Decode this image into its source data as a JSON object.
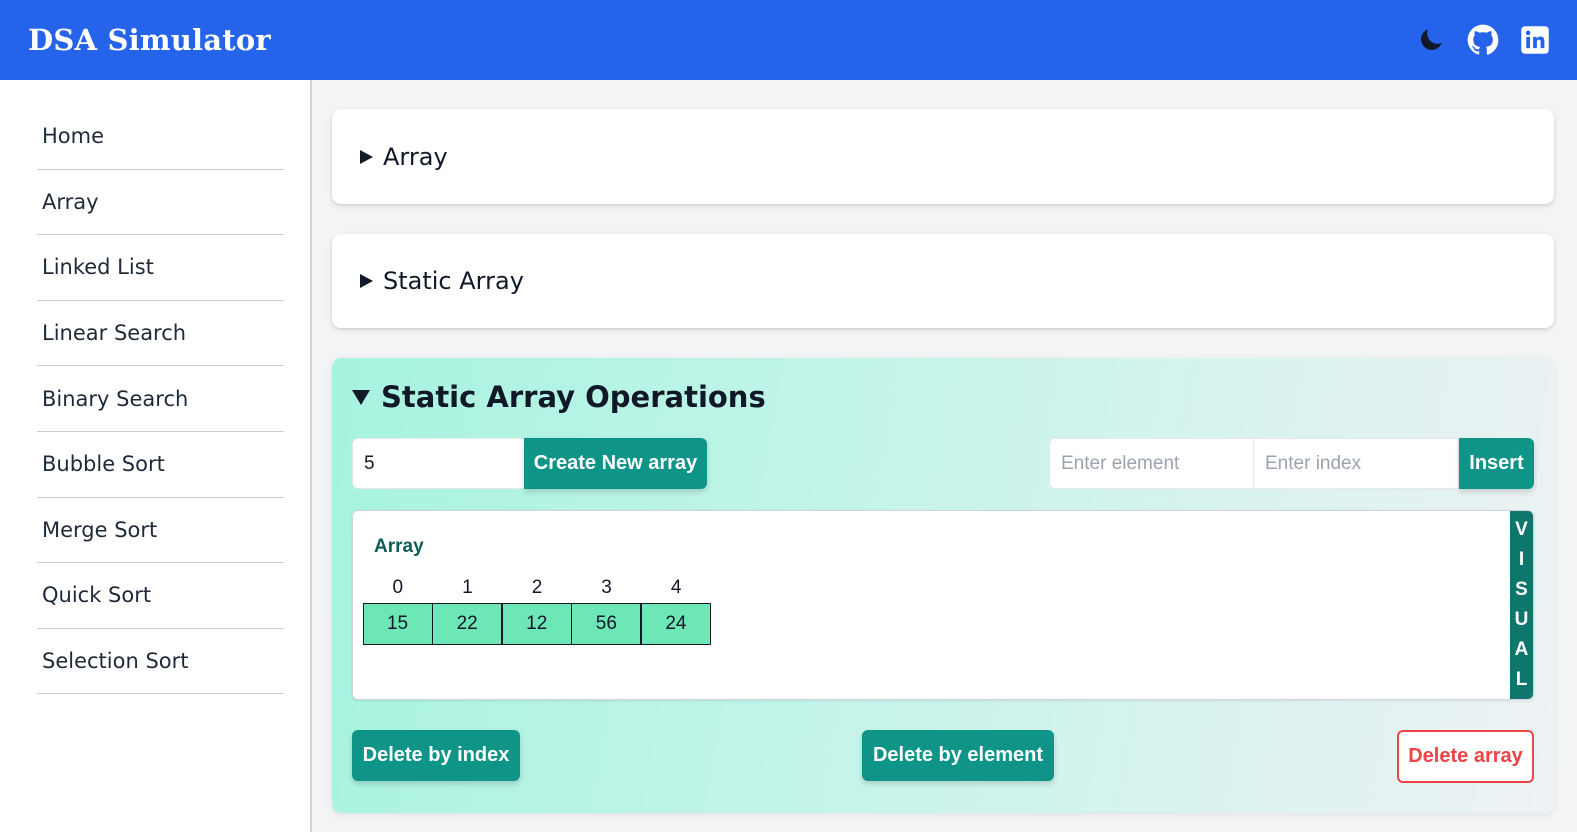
{
  "header": {
    "title": "DSA Simulator",
    "icons": [
      "moon-icon",
      "github-icon",
      "linkedin-icon"
    ]
  },
  "sidebar": {
    "items": [
      {
        "label": "Home"
      },
      {
        "label": "Array"
      },
      {
        "label": "Linked List"
      },
      {
        "label": "Linear Search"
      },
      {
        "label": "Binary Search"
      },
      {
        "label": "Bubble Sort"
      },
      {
        "label": "Merge Sort"
      },
      {
        "label": "Quick Sort"
      },
      {
        "label": "Selection Sort"
      }
    ]
  },
  "main": {
    "sections": [
      {
        "title": "Array",
        "expanded": false
      },
      {
        "title": "Static Array",
        "expanded": false
      }
    ],
    "operations": {
      "title": "Static Array Operations",
      "expanded": true,
      "size_input_value": "5",
      "create_button": "Create New array",
      "element_placeholder": "Enter element",
      "index_placeholder": "Enter index",
      "insert_button": "Insert",
      "array_label": "Array",
      "indices": [
        "0",
        "1",
        "2",
        "3",
        "4"
      ],
      "values": [
        "15",
        "22",
        "12",
        "56",
        "24"
      ],
      "visual_tab": [
        "V",
        "I",
        "S",
        "U",
        "A",
        "L"
      ],
      "delete_index_button": "Delete by index",
      "delete_element_button": "Delete by element",
      "delete_array_button": "Delete array"
    }
  },
  "colors": {
    "header_bg": "#2563eb",
    "teal": "#0f9488",
    "cell_fill": "#6ee7b7",
    "danger": "#ef4444"
  }
}
